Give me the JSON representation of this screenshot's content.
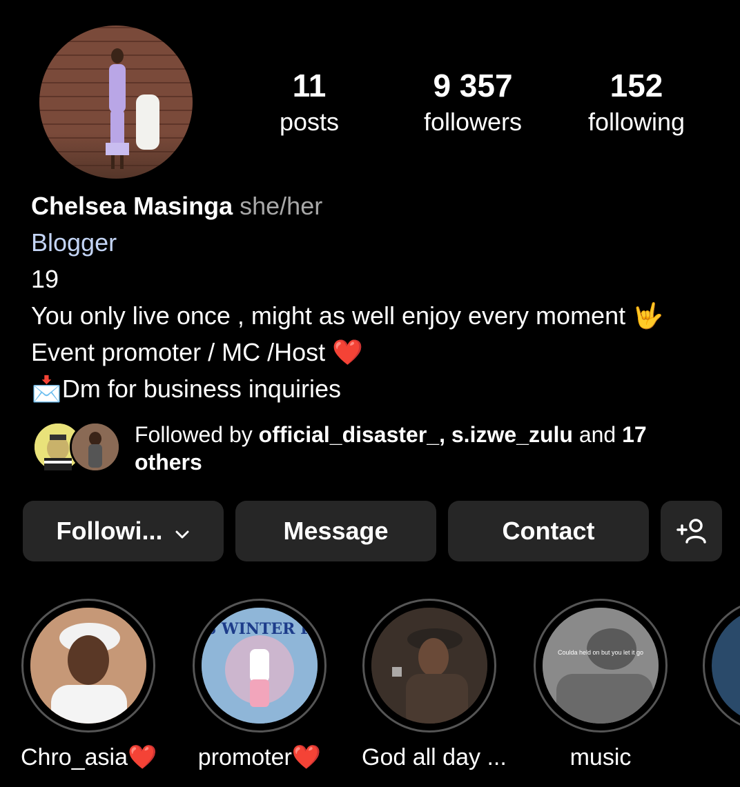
{
  "profile": {
    "avatar_icon": "profile-photo",
    "name": "Chelsea Masinga",
    "pronouns": "she/her",
    "category": "Blogger",
    "bio_lines": [
      "19",
      "You only live once , might as well enjoy every moment 🤟",
      "Event promoter  / MC /Host ❤️",
      "📩Dm for business inquiries"
    ]
  },
  "stats": {
    "posts": {
      "value": "11",
      "label": "posts"
    },
    "followers": {
      "value": "9 357",
      "label": "followers"
    },
    "following": {
      "value": "152",
      "label": "following"
    }
  },
  "followed_by": {
    "prefix": "Followed by ",
    "user1": "official_disaster_",
    "sep": ", ",
    "user2": "s.izwe_zulu",
    "suffix": " and ",
    "others": "17 others"
  },
  "buttons": {
    "following": "Followi...",
    "message": "Message",
    "contact": "Contact",
    "add_user_icon": "add-person-icon"
  },
  "highlights": [
    {
      "label": "Chro_asia❤️",
      "cover_text": ""
    },
    {
      "label": "promoter❤️",
      "cover_text": "OASIS WINTER PARTY"
    },
    {
      "label": "God all day ...",
      "cover_text": ""
    },
    {
      "label": "music",
      "cover_text": "Coulda held on but you let it go"
    }
  ],
  "colors": {
    "background": "#000000",
    "button": "#262626",
    "category": "#c3d4f5",
    "pronoun": "#a8a8a8"
  }
}
